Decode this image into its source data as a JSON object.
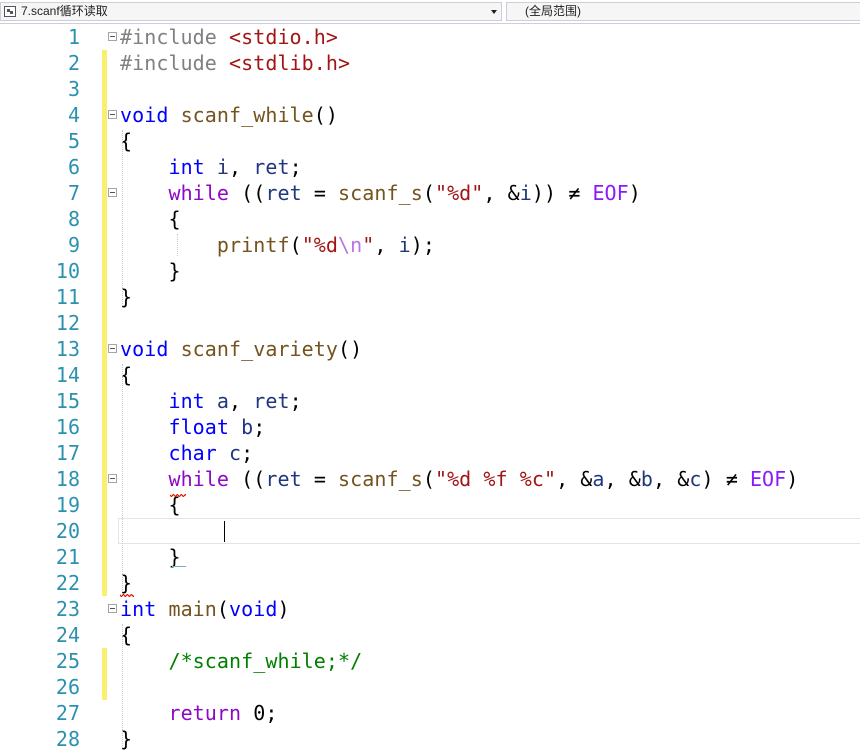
{
  "navbar": {
    "file_label": "7.scanf循环读取",
    "scope_label": "(全局范围)",
    "file_icon": "file-icon",
    "dropdown_icon": "chevron-down-icon"
  },
  "editor": {
    "lines": [
      {
        "n": "1",
        "tokens": [
          {
            "t": "#include ",
            "c": "pp"
          },
          {
            "t": "<stdio.h>",
            "c": "inc"
          }
        ],
        "fold": true,
        "chg": false
      },
      {
        "n": "2",
        "tokens": [
          {
            "t": "#include ",
            "c": "pp"
          },
          {
            "t": "<stdlib.h>",
            "c": "inc"
          }
        ],
        "fold": false,
        "chg": true
      },
      {
        "n": "3",
        "tokens": [],
        "fold": false,
        "chg": true
      },
      {
        "n": "4",
        "tokens": [
          {
            "t": "void ",
            "c": "kw"
          },
          {
            "t": "scanf_while",
            "c": "fn"
          },
          {
            "t": "()",
            "c": ""
          }
        ],
        "fold": true,
        "chg": true
      },
      {
        "n": "5",
        "tokens": [
          {
            "t": "{",
            "c": ""
          }
        ],
        "fold": false,
        "chg": true
      },
      {
        "n": "6",
        "tokens": [
          {
            "t": "    ",
            "c": ""
          },
          {
            "t": "int ",
            "c": "kw"
          },
          {
            "t": "i",
            "c": "var"
          },
          {
            "t": ", ",
            "c": ""
          },
          {
            "t": "ret",
            "c": "var"
          },
          {
            "t": ";",
            "c": ""
          }
        ],
        "fold": false,
        "chg": true
      },
      {
        "n": "7",
        "tokens": [
          {
            "t": "    ",
            "c": ""
          },
          {
            "t": "while ",
            "c": "ctl"
          },
          {
            "t": "((",
            "c": ""
          },
          {
            "t": "ret",
            "c": "var"
          },
          {
            "t": " = ",
            "c": ""
          },
          {
            "t": "scanf_s",
            "c": "fn"
          },
          {
            "t": "(",
            "c": ""
          },
          {
            "t": "\"%d\"",
            "c": "str"
          },
          {
            "t": ", &",
            "c": ""
          },
          {
            "t": "i",
            "c": "var"
          },
          {
            "t": ")) ≠ ",
            "c": ""
          },
          {
            "t": "EOF",
            "c": "mac"
          },
          {
            "t": ")",
            "c": ""
          }
        ],
        "fold": true,
        "chg": true
      },
      {
        "n": "8",
        "tokens": [
          {
            "t": "    {",
            "c": ""
          }
        ],
        "fold": false,
        "chg": true
      },
      {
        "n": "9",
        "tokens": [
          {
            "t": "        ",
            "c": ""
          },
          {
            "t": "printf",
            "c": "fn"
          },
          {
            "t": "(",
            "c": ""
          },
          {
            "t": "\"%d",
            "c": "str"
          },
          {
            "t": "\\n",
            "c": "esc"
          },
          {
            "t": "\"",
            "c": "str"
          },
          {
            "t": ", ",
            "c": ""
          },
          {
            "t": "i",
            "c": "var"
          },
          {
            "t": ");",
            "c": ""
          }
        ],
        "fold": false,
        "chg": true
      },
      {
        "n": "10",
        "tokens": [
          {
            "t": "    }",
            "c": ""
          }
        ],
        "fold": false,
        "chg": true
      },
      {
        "n": "11",
        "tokens": [
          {
            "t": "}",
            "c": ""
          }
        ],
        "fold": false,
        "chg": true
      },
      {
        "n": "12",
        "tokens": [],
        "fold": false,
        "chg": true
      },
      {
        "n": "13",
        "tokens": [
          {
            "t": "void ",
            "c": "kw"
          },
          {
            "t": "scanf_variety",
            "c": "fn"
          },
          {
            "t": "()",
            "c": ""
          }
        ],
        "fold": true,
        "chg": true
      },
      {
        "n": "14",
        "tokens": [
          {
            "t": "{",
            "c": ""
          }
        ],
        "fold": false,
        "chg": true
      },
      {
        "n": "15",
        "tokens": [
          {
            "t": "    ",
            "c": ""
          },
          {
            "t": "int ",
            "c": "kw"
          },
          {
            "t": "a",
            "c": "var"
          },
          {
            "t": ", ",
            "c": ""
          },
          {
            "t": "ret",
            "c": "var"
          },
          {
            "t": ";",
            "c": ""
          }
        ],
        "fold": false,
        "chg": true
      },
      {
        "n": "16",
        "tokens": [
          {
            "t": "    ",
            "c": ""
          },
          {
            "t": "float ",
            "c": "kw"
          },
          {
            "t": "b",
            "c": "var"
          },
          {
            "t": ";",
            "c": ""
          }
        ],
        "fold": false,
        "chg": true
      },
      {
        "n": "17",
        "tokens": [
          {
            "t": "    ",
            "c": ""
          },
          {
            "t": "char ",
            "c": "kw"
          },
          {
            "t": "c",
            "c": "var"
          },
          {
            "t": ";",
            "c": ""
          }
        ],
        "fold": false,
        "chg": true
      },
      {
        "n": "18",
        "tokens": [
          {
            "t": "    ",
            "c": ""
          },
          {
            "t": "while ",
            "c": "ctl"
          },
          {
            "t": "((",
            "c": ""
          },
          {
            "t": "ret",
            "c": "var"
          },
          {
            "t": " = ",
            "c": ""
          },
          {
            "t": "scanf_s",
            "c": "fn"
          },
          {
            "t": "(",
            "c": ""
          },
          {
            "t": "\"%d %f %c\"",
            "c": "str"
          },
          {
            "t": ", &",
            "c": ""
          },
          {
            "t": "a",
            "c": "var"
          },
          {
            "t": ", &",
            "c": ""
          },
          {
            "t": "b",
            "c": "var"
          },
          {
            "t": ", &",
            "c": ""
          },
          {
            "t": "c",
            "c": "var"
          },
          {
            "t": ") ≠ ",
            "c": ""
          },
          {
            "t": "EOF",
            "c": "mac"
          },
          {
            "t": ")",
            "c": ""
          }
        ],
        "fold": true,
        "chg": true
      },
      {
        "n": "19",
        "tokens": [
          {
            "t": "    {",
            "c": ""
          }
        ],
        "fold": false,
        "chg": true
      },
      {
        "n": "20",
        "tokens": [],
        "fold": false,
        "chg": true,
        "current": true
      },
      {
        "n": "21",
        "tokens": [
          {
            "t": "    }",
            "c": ""
          }
        ],
        "fold": false,
        "chg": true
      },
      {
        "n": "22",
        "tokens": [
          {
            "t": "}",
            "c": ""
          }
        ],
        "fold": false,
        "chg": true
      },
      {
        "n": "23",
        "tokens": [
          {
            "t": "int ",
            "c": "kw"
          },
          {
            "t": "main",
            "c": "fn"
          },
          {
            "t": "(",
            "c": ""
          },
          {
            "t": "void",
            "c": "kw"
          },
          {
            "t": ")",
            "c": ""
          }
        ],
        "fold": true,
        "chg": false
      },
      {
        "n": "24",
        "tokens": [
          {
            "t": "{",
            "c": ""
          }
        ],
        "fold": false,
        "chg": false
      },
      {
        "n": "25",
        "tokens": [
          {
            "t": "    ",
            "c": ""
          },
          {
            "t": "/*scanf_while;*/",
            "c": "com"
          }
        ],
        "fold": false,
        "chg": true
      },
      {
        "n": "26",
        "tokens": [],
        "fold": false,
        "chg": true
      },
      {
        "n": "27",
        "tokens": [
          {
            "t": "    ",
            "c": ""
          },
          {
            "t": "return ",
            "c": "ctl"
          },
          {
            "t": "0",
            "c": "num"
          },
          {
            "t": ";",
            "c": ""
          }
        ],
        "fold": false,
        "chg": false
      },
      {
        "n": "28",
        "tokens": [
          {
            "t": "}",
            "c": ""
          }
        ],
        "fold": false,
        "chg": false
      }
    ]
  },
  "colors": {
    "line_number": "#2b91af",
    "change_bar": "#f8ef71",
    "keyword": "#0000ff",
    "control": "#8f08c4",
    "function": "#74531f",
    "variable": "#1f377f",
    "string": "#a31515",
    "macro": "#8a1bff",
    "comment": "#008000"
  }
}
